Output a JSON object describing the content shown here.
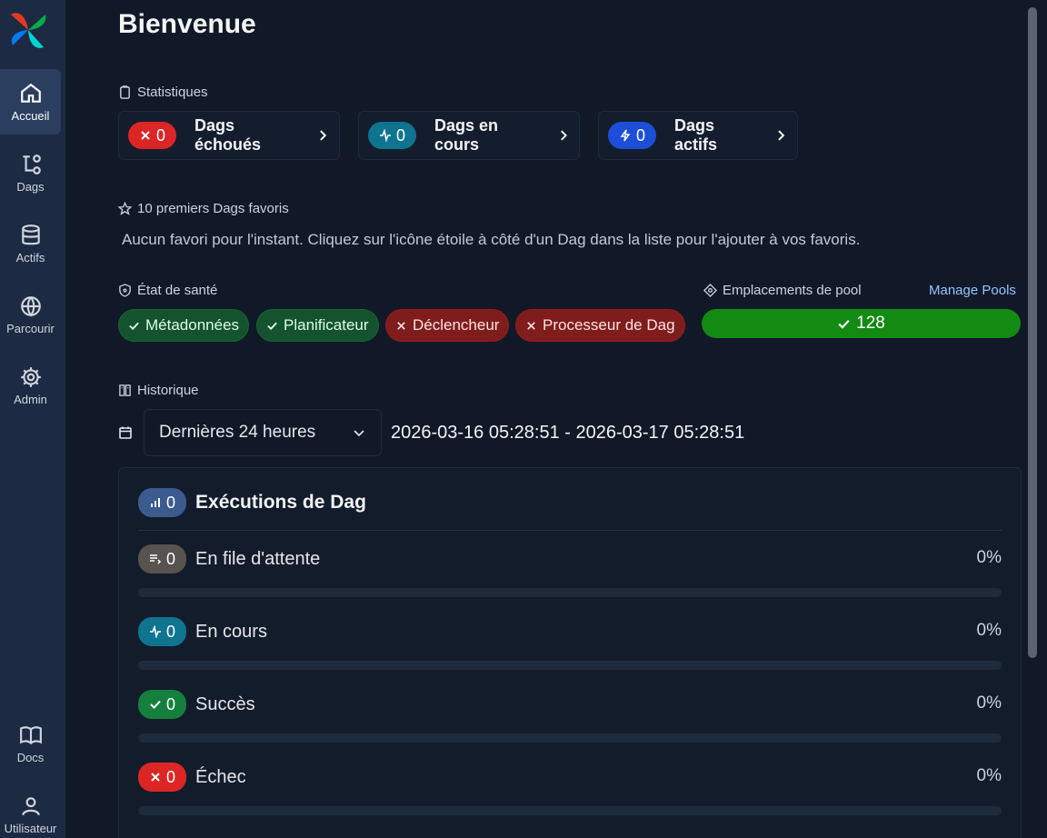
{
  "sidebar": {
    "items": [
      {
        "label": "Accueil",
        "icon": "home-icon"
      },
      {
        "label": "Dags",
        "icon": "dags-icon"
      },
      {
        "label": "Actifs",
        "icon": "database-icon"
      },
      {
        "label": "Parcourir",
        "icon": "globe-icon"
      },
      {
        "label": "Admin",
        "icon": "gear-icon"
      },
      {
        "label": "Docs",
        "icon": "book-icon"
      },
      {
        "label": "Utilisateur",
        "icon": "user-icon"
      }
    ]
  },
  "page": {
    "title": "Bienvenue"
  },
  "stats": {
    "label": "Statistiques",
    "cards": [
      {
        "count": "0",
        "label": "Dags échoués",
        "color": "#dc2626"
      },
      {
        "count": "0",
        "label": "Dags en cours",
        "color": "#0e7490"
      },
      {
        "count": "0",
        "label": "Dags actifs",
        "color": "#1d4ed8"
      }
    ]
  },
  "favorites": {
    "label": "10 premiers Dags favoris",
    "empty_text": "Aucun favori pour l'instant. Cliquez sur l'icône étoile à côté d'un Dag dans la liste pour l'ajouter à vos favoris."
  },
  "health": {
    "label": "État de santé",
    "items": [
      {
        "label": "Métadonnées",
        "status": "ok"
      },
      {
        "label": "Planificateur",
        "status": "ok"
      },
      {
        "label": "Déclencheur",
        "status": "bad"
      },
      {
        "label": "Processeur de Dag",
        "status": "bad"
      }
    ]
  },
  "pool": {
    "label": "Emplacements de pool",
    "manage_label": "Manage Pools",
    "value": "128",
    "color": "#138a12"
  },
  "history": {
    "label": "Historique",
    "range_select": "Dernières 24 heures",
    "range_text": "2026-03-16 05:28:51 - 2026-03-17 05:28:51"
  },
  "runs": {
    "count": "0",
    "title": "Exécutions de Dag",
    "rows": [
      {
        "count": "0",
        "label": "En file d'attente",
        "pct": "0%",
        "fraction": 0,
        "color": "#57534e"
      },
      {
        "count": "0",
        "label": "En cours",
        "pct": "0%",
        "fraction": 0,
        "color": "#0e7490"
      },
      {
        "count": "0",
        "label": "Succès",
        "pct": "0%",
        "fraction": 0,
        "color": "#15803d"
      },
      {
        "count": "0",
        "label": "Échec",
        "pct": "0%",
        "fraction": 0,
        "color": "#dc2626"
      }
    ]
  }
}
